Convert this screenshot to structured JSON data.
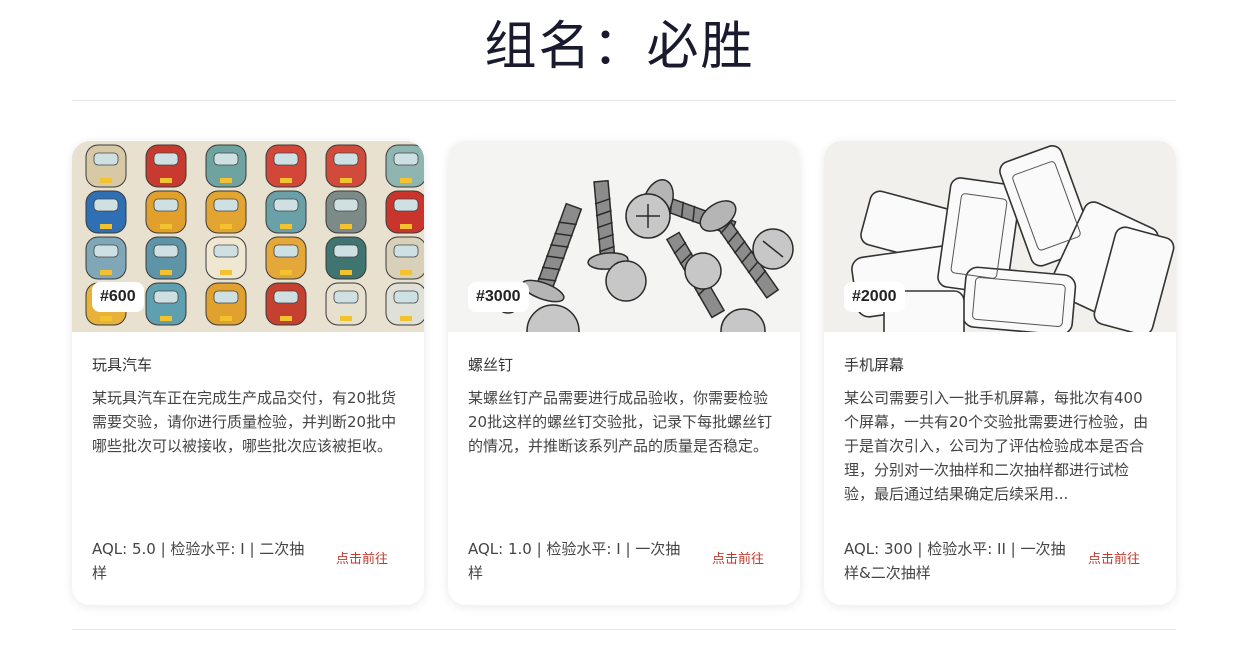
{
  "header": {
    "title": "组名：必胜"
  },
  "cards": [
    {
      "badge": "#600",
      "name": "玩具汽车",
      "description": "某玩具汽车正在完成生产成品交付，有20批货需要交验，请你进行质量检验，并判断20批中哪些批次可以被接收，哪些批次应该被拒收。",
      "spec": "AQL: 5.0 | 检验水平: I | 二次抽样",
      "link": "点击前往",
      "image_icon": "toy-cars-grid"
    },
    {
      "badge": "#3000",
      "name": "螺丝钉",
      "description": "某螺丝钉产品需要进行成品验收，你需要检验20批这样的螺丝钉交验批，记录下每批螺丝钉的情况，并推断该系列产品的质量是否稳定。",
      "spec": "AQL: 1.0 | 检验水平: I | 一次抽样",
      "link": "点击前往",
      "image_icon": "screws-sketch"
    },
    {
      "badge": "#2000",
      "name": "手机屏幕",
      "description": "某公司需要引入一批手机屏幕，每批次有400个屏幕，一共有20个交验批需要进行检验，由于是首次引入，公司为了评估检验成本是否合理，分别对一次抽样和二次抽样都进行试检验，最后通过结果确定后续采用...",
      "spec": "AQL: 300 | 检验水平: II | 一次抽样&二次抽样",
      "link": "点击前往",
      "image_icon": "phones-sketch"
    }
  ]
}
